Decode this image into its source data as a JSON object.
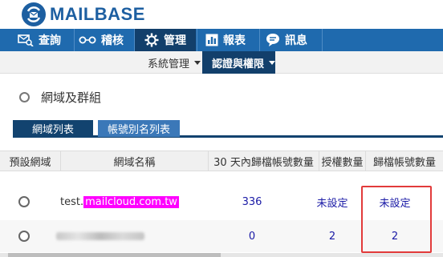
{
  "app": {
    "logo_text": "MAILBASE"
  },
  "main_nav": [
    {
      "label": "查詢",
      "icon": "mail-search-icon"
    },
    {
      "label": "稽核",
      "icon": "glasses-icon"
    },
    {
      "label": "管理",
      "icon": "gear-icon",
      "active": true
    },
    {
      "label": "報表",
      "icon": "bar-chart-icon"
    },
    {
      "label": "訊息",
      "icon": "chat-bubble-icon"
    }
  ],
  "sub_nav": [
    {
      "label": "系統管理",
      "has_dropdown": true
    },
    {
      "label": "認證與權限",
      "has_dropdown": true,
      "active": true
    }
  ],
  "section_title": "網域及群組",
  "tabs": [
    {
      "label": "網域列表",
      "active": true
    },
    {
      "label": "帳號別名列表",
      "active": false
    }
  ],
  "table": {
    "headers": [
      "預設網域",
      "網域名稱",
      "30 天內歸檔帳號數量",
      "授權數量",
      "歸檔帳號數量"
    ],
    "rows": [
      {
        "domain_prefix": "test.",
        "domain_highlight": "mailcloud.com.tw",
        "archived_30d": "336",
        "licensed": "未設定",
        "archived": "未設定"
      },
      {
        "domain_prefix": "",
        "domain_highlight": "",
        "domain_redacted": true,
        "archived_30d": "0",
        "licensed": "2",
        "archived": "2"
      }
    ]
  },
  "colors": {
    "brand": "#1d5fa1",
    "nav_bg": "#1f6aae",
    "nav_active": "#123f6b",
    "link": "#1a1aa6",
    "highlight": "#ff00ff",
    "annotation": "#e23b3b"
  }
}
